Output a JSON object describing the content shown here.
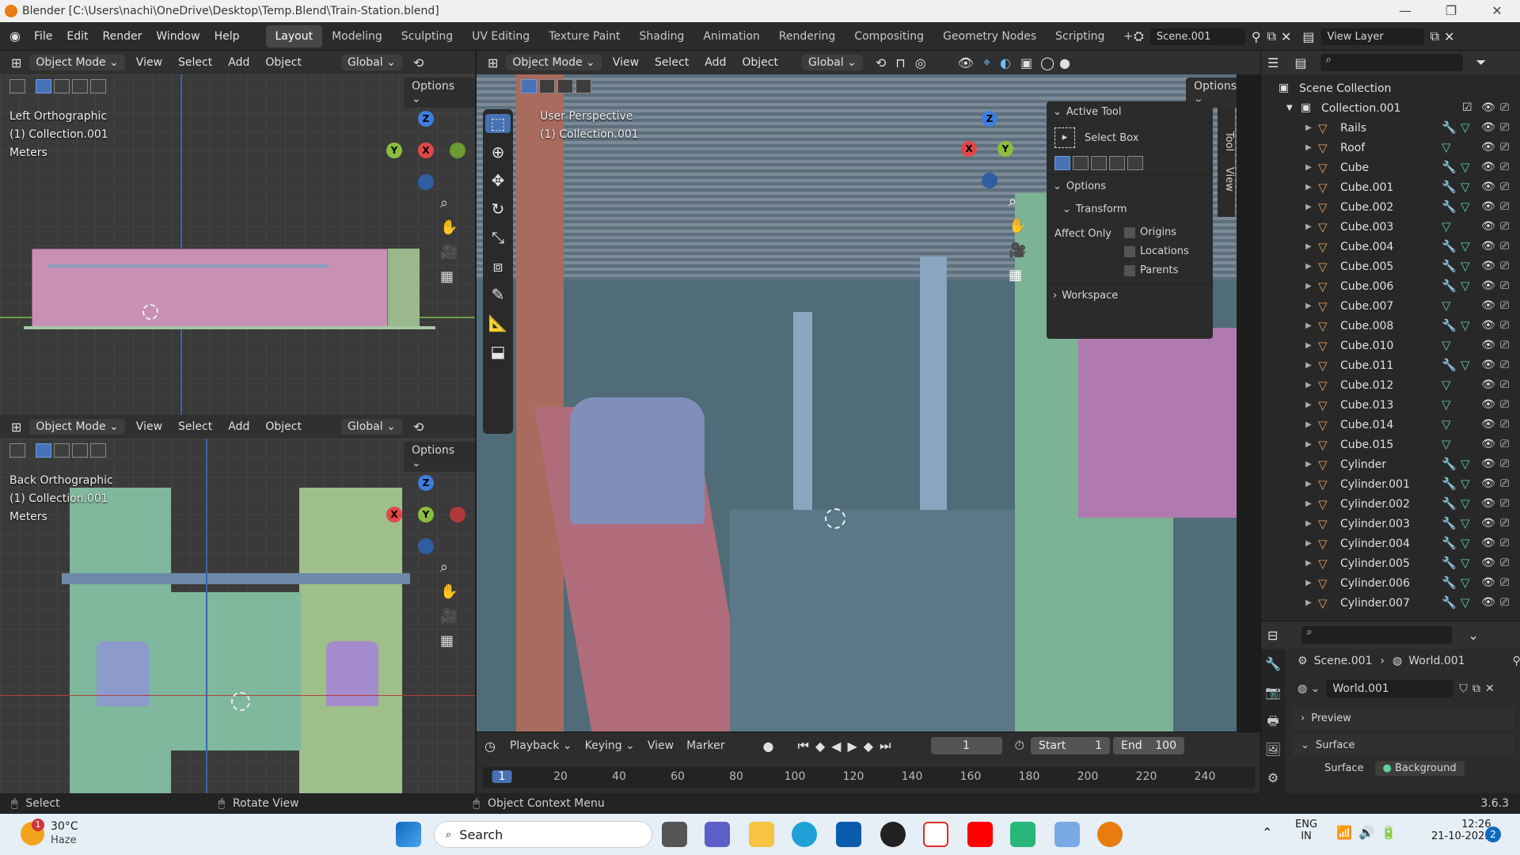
{
  "window": {
    "title": "Blender [C:\\Users\\nachi\\OneDrive\\Desktop\\Temp.Blend\\Train-Station.blend]",
    "minimize": "—",
    "maximize": "❐",
    "close": "✕"
  },
  "menu": {
    "items": [
      "File",
      "Edit",
      "Render",
      "Window",
      "Help"
    ],
    "workspaces": [
      "Layout",
      "Modeling",
      "Sculpting",
      "UV Editing",
      "Texture Paint",
      "Shading",
      "Animation",
      "Rendering",
      "Compositing",
      "Geometry Nodes",
      "Scripting"
    ],
    "active_workspace": "Layout",
    "add_workspace": "+",
    "scene": "Scene.001",
    "view_layer": "View Layer"
  },
  "viewport_header": {
    "mode": "Object Mode",
    "menus": [
      "View",
      "Select",
      "Add",
      "Object"
    ],
    "orientation": "Global",
    "options": "Options"
  },
  "left_top": {
    "view": "Left Orthographic",
    "collection": "(1) Collection.001",
    "units": "Meters"
  },
  "left_bottom": {
    "view": "Back Orthographic",
    "collection": "(1) Collection.001",
    "units": "Meters"
  },
  "main_view": {
    "view": "User Perspective",
    "collection": "(1) Collection.001"
  },
  "gizmo": {
    "x": "X",
    "y": "Y",
    "z": "Z"
  },
  "npanel": {
    "active_tool_header": "Active Tool",
    "tool_name": "Select Box",
    "options_header": "Options",
    "transform_header": "Transform",
    "affect_only": "Affect Only",
    "checks": [
      "Origins",
      "Locations",
      "Parents"
    ],
    "workspace_header": "Workspace",
    "tabs": [
      "Tool",
      "View"
    ]
  },
  "outliner": {
    "scene_collection": "Scene Collection",
    "collection": "Collection.001",
    "objects": [
      {
        "name": "Rails",
        "mod": true
      },
      {
        "name": "Roof",
        "mod": false
      },
      {
        "name": "Cube",
        "mod": true
      },
      {
        "name": "Cube.001",
        "mod": true
      },
      {
        "name": "Cube.002",
        "mod": true
      },
      {
        "name": "Cube.003",
        "mod": false
      },
      {
        "name": "Cube.004",
        "mod": true
      },
      {
        "name": "Cube.005",
        "mod": true
      },
      {
        "name": "Cube.006",
        "mod": true
      },
      {
        "name": "Cube.007",
        "mod": false
      },
      {
        "name": "Cube.008",
        "mod": true
      },
      {
        "name": "Cube.010",
        "mod": false
      },
      {
        "name": "Cube.011",
        "mod": true
      },
      {
        "name": "Cube.012",
        "mod": false
      },
      {
        "name": "Cube.013",
        "mod": false
      },
      {
        "name": "Cube.014",
        "mod": false
      },
      {
        "name": "Cube.015",
        "mod": false
      },
      {
        "name": "Cylinder",
        "mod": true
      },
      {
        "name": "Cylinder.001",
        "mod": true
      },
      {
        "name": "Cylinder.002",
        "mod": true
      },
      {
        "name": "Cylinder.003",
        "mod": true
      },
      {
        "name": "Cylinder.004",
        "mod": true
      },
      {
        "name": "Cylinder.005",
        "mod": true
      },
      {
        "name": "Cylinder.006",
        "mod": true
      },
      {
        "name": "Cylinder.007",
        "mod": true
      }
    ]
  },
  "properties": {
    "scene": "Scene.001",
    "world": "World.001",
    "world_field": "World.001",
    "preview": "Preview",
    "surface": "Surface",
    "surface_label": "Surface",
    "background": "Background"
  },
  "timeline": {
    "menus": [
      "Playback",
      "Keying",
      "View",
      "Marker"
    ],
    "current_frame": "1",
    "start_label": "Start",
    "start": "1",
    "end_label": "End",
    "end": "100",
    "ruler": [
      "1",
      "20",
      "40",
      "60",
      "80",
      "100",
      "120",
      "140",
      "160",
      "180",
      "200",
      "220",
      "240"
    ]
  },
  "status": {
    "select": "Select",
    "rotate": "Rotate View",
    "context": "Object Context Menu",
    "version": "3.6.3"
  },
  "taskbar": {
    "weather_temp": "30°C",
    "weather_desc": "Haze",
    "weather_badge": "1",
    "search": "Search",
    "lang": "ENG",
    "region": "IN",
    "time": "12:26",
    "date": "21-10-2023",
    "notif": "2"
  }
}
